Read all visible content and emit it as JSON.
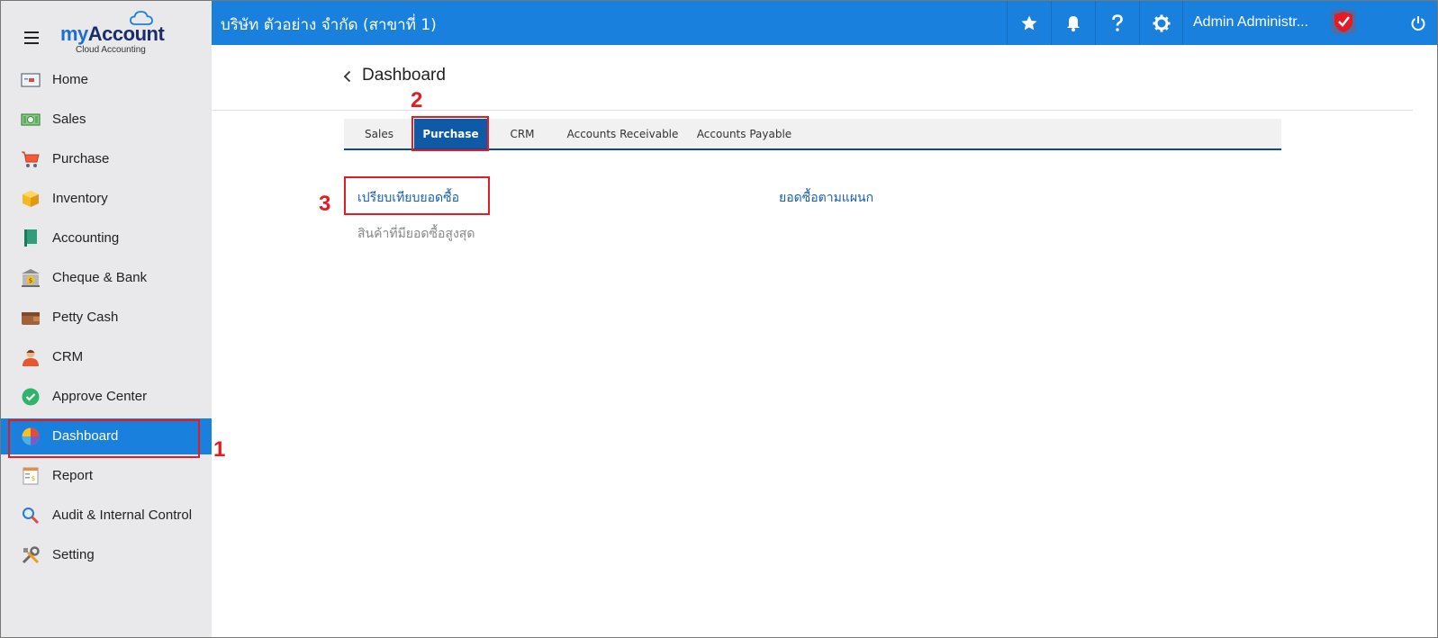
{
  "sidebar": {
    "logo": {
      "prefix": "my",
      "main": "Account",
      "sub": "Cloud Accounting"
    },
    "items": [
      {
        "label": "Home",
        "icon": "home-icon"
      },
      {
        "label": "Sales",
        "icon": "money-icon"
      },
      {
        "label": "Purchase",
        "icon": "cart-icon"
      },
      {
        "label": "Inventory",
        "icon": "box-icon"
      },
      {
        "label": "Accounting",
        "icon": "book-icon"
      },
      {
        "label": "Cheque & Bank",
        "icon": "bank-icon"
      },
      {
        "label": "Petty Cash",
        "icon": "wallet-icon"
      },
      {
        "label": "CRM",
        "icon": "person-icon"
      },
      {
        "label": "Approve Center",
        "icon": "check-circle-icon"
      },
      {
        "label": "Dashboard",
        "icon": "pie-chart-icon",
        "active": true
      },
      {
        "label": "Report",
        "icon": "report-icon"
      },
      {
        "label": "Audit & Internal Control",
        "icon": "magnifier-icon"
      },
      {
        "label": "Setting",
        "icon": "tools-icon"
      }
    ]
  },
  "topbar": {
    "company": "บริษัท ตัวอย่าง จำกัด (สาขาที่ 1)",
    "user": "Admin Administr...",
    "icons": [
      "star-icon",
      "bell-icon",
      "help-icon",
      "gear-icon",
      "power-icon"
    ]
  },
  "page": {
    "title": "Dashboard"
  },
  "tabs": [
    {
      "label": "Sales"
    },
    {
      "label": "Purchase",
      "active": true
    },
    {
      "label": "CRM"
    },
    {
      "label": "Accounts Receivable"
    },
    {
      "label": "Accounts Payable"
    }
  ],
  "links": {
    "compare_purchase": "เปรียบเทียบยอดซื้อ",
    "purchase_by_department": "ยอดซื้อตามแผนก",
    "top_products": "สินค้าที่มียอดซื้อสูงสุด"
  },
  "markers": [
    "1",
    "2",
    "3"
  ],
  "colors": {
    "accent": "#1a80dd",
    "tab_active": "#0e5aa7",
    "highlight": "#e41b23",
    "sidebar_bg": "#e9e9eb"
  }
}
